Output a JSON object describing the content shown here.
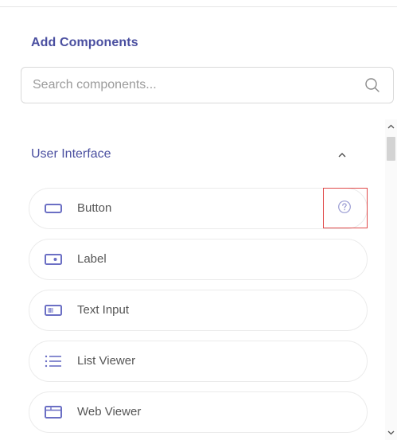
{
  "panel": {
    "title": "Add Components"
  },
  "search": {
    "placeholder": "Search components...",
    "value": "",
    "icon": "search-icon"
  },
  "section": {
    "title": "User Interface",
    "collapse_icon": "chevron-up-icon",
    "items": [
      {
        "label": "Button",
        "icon": "button-icon"
      },
      {
        "label": "Label",
        "icon": "label-icon"
      },
      {
        "label": "Text Input",
        "icon": "text-input-icon"
      },
      {
        "label": "List Viewer",
        "icon": "list-icon"
      },
      {
        "label": "Web Viewer",
        "icon": "web-viewer-icon"
      }
    ],
    "help_icon": "help-circle-icon"
  },
  "colors": {
    "accent": "#4a4fa0",
    "icon": "#6b6fc4",
    "highlight": "#e04a4a",
    "border": "#ebebeb"
  }
}
